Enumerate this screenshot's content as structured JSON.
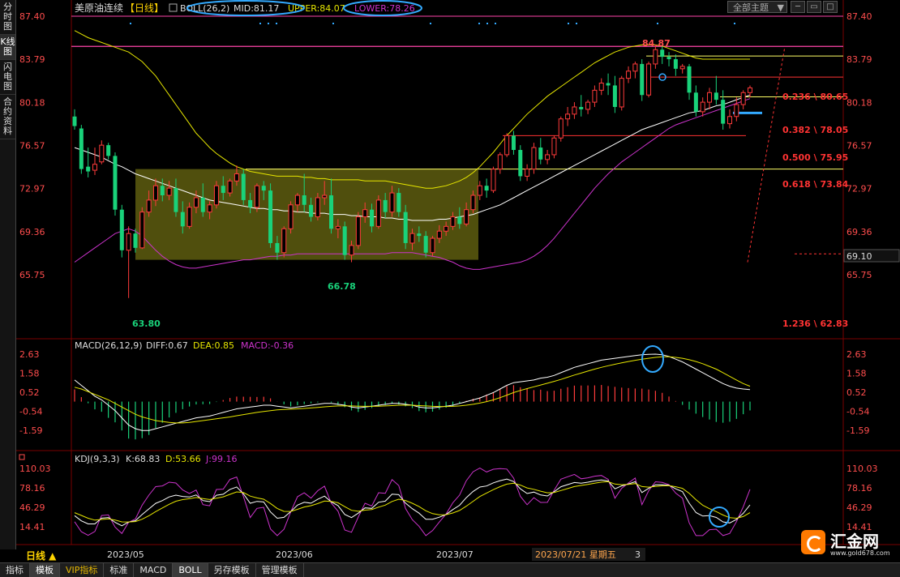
{
  "left_toolbar": [
    {
      "label": "分时图"
    },
    {
      "label": "K线图",
      "active": true
    },
    {
      "label": "闪电图"
    },
    {
      "label": "合约资料"
    }
  ],
  "header": {
    "symbol": "美原油连续",
    "period_tag": "【日线】",
    "boll": "BOLL(26,2)",
    "mid": "MID:81.17",
    "upper": "UPPER:84.07",
    "lower": "LOWER:78.26",
    "theme_select": "全部主题",
    "theme_arrow": "▼"
  },
  "main_axis": {
    "labels": [
      "87.40",
      "83.79",
      "80.18",
      "76.57",
      "72.97",
      "69.36",
      "65.75"
    ],
    "current_price": "69.10"
  },
  "annotations": {
    "high": "84.87",
    "low1": "63.80",
    "low2": "66.78",
    "fib": [
      "0.236 \\ 80.65",
      "0.382 \\ 78.05",
      "0.500 \\ 75.95",
      "0.618 \\ 73.84",
      "1.236 \\ 62.83"
    ]
  },
  "macd": {
    "label": "MACD(26,12,9)",
    "diff": "DIFF:0.67",
    "dea": "DEA:0.85",
    "macd": "MACD:-0.36",
    "axis": [
      "2.63",
      "1.58",
      "0.52",
      "-0.54",
      "-1.59"
    ]
  },
  "kdj": {
    "label": "KDJ(9,3,3)",
    "k": "K:68.83",
    "d": "D:53.66",
    "j": "J:99.16",
    "axis": [
      "110.03",
      "78.16",
      "46.29",
      "14.41"
    ]
  },
  "x_axis": {
    "labels": [
      "2023/05",
      "2023/06",
      "2023/07"
    ],
    "cursor_date": "2023/07/21 星期五",
    "cursor_extra": "3",
    "period": "日线 ▲"
  },
  "bottom_tabs": [
    {
      "label": "指标"
    },
    {
      "label": "模板",
      "active": true
    },
    {
      "label": "VIP指标",
      "vip": true
    },
    {
      "label": "标准"
    },
    {
      "label": "MACD"
    },
    {
      "label": "BOLL",
      "active": true
    },
    {
      "label": "另存模板"
    },
    {
      "label": "管理模板"
    }
  ],
  "logo": {
    "name": "汇金网",
    "site": "www.gold678.com"
  },
  "colors": {
    "up": "#ff3b3b",
    "down": "#19d27a",
    "mid": "#ffffff",
    "upper": "#e6e600",
    "lower": "#cc33cc",
    "box": "#6b6a12",
    "fib_line": "#ffff66",
    "fib_text": "#ff3333",
    "magenta_line": "#ff44aa",
    "circle": "#33aaff",
    "axis_text": "#ff4d4d"
  },
  "chart_data": {
    "type": "candlestick",
    "title": "美原油连续【日线】",
    "y_range": [
      62.0,
      88.0
    ],
    "x_range": [
      "2023/04/14",
      "2023/07/21"
    ],
    "candles": [
      [
        79.0,
        79.6,
        78.2,
        77.9
      ],
      [
        78.0,
        78.3,
        74.6,
        74.2
      ],
      [
        74.8,
        76.4,
        74.4,
        73.9
      ],
      [
        74.5,
        76.4,
        75.0,
        74.1
      ],
      [
        75.2,
        77.0,
        76.6,
        75.0
      ],
      [
        76.6,
        76.8,
        75.7,
        75.4
      ],
      [
        75.7,
        76.0,
        71.2,
        70.7
      ],
      [
        71.2,
        71.6,
        67.8,
        67.2
      ],
      [
        67.8,
        69.8,
        69.2,
        63.8
      ],
      [
        69.2,
        69.6,
        68.0,
        67.6
      ],
      [
        68.0,
        71.4,
        71.0,
        67.9
      ],
      [
        71.0,
        72.8,
        72.0,
        70.6
      ],
      [
        72.0,
        73.8,
        73.2,
        71.5
      ],
      [
        73.2,
        73.8,
        72.4,
        71.9
      ],
      [
        72.4,
        73.6,
        73.0,
        72.0
      ],
      [
        73.0,
        73.8,
        71.0,
        70.6
      ],
      [
        71.0,
        71.9,
        69.8,
        69.2
      ],
      [
        69.8,
        71.8,
        71.4,
        69.6
      ],
      [
        71.4,
        72.8,
        72.2,
        70.9
      ],
      [
        72.2,
        73.4,
        71.0,
        70.6
      ],
      [
        71.0,
        71.9,
        71.6,
        70.4
      ],
      [
        71.6,
        73.6,
        73.2,
        71.3
      ],
      [
        73.2,
        74.0,
        72.6,
        72.0
      ],
      [
        72.6,
        73.8,
        73.6,
        72.3
      ],
      [
        73.6,
        74.9,
        74.2,
        73.2
      ],
      [
        74.2,
        74.6,
        72.0,
        71.6
      ],
      [
        72.0,
        72.6,
        71.4,
        70.9
      ],
      [
        71.4,
        73.4,
        73.2,
        71.0
      ],
      [
        73.2,
        73.6,
        72.8,
        72.0
      ],
      [
        72.8,
        73.4,
        68.4,
        68.0
      ],
      [
        68.4,
        69.0,
        67.6,
        67.0
      ],
      [
        67.6,
        69.8,
        69.6,
        67.2
      ],
      [
        69.6,
        71.9,
        71.6,
        69.2
      ],
      [
        71.6,
        72.6,
        72.4,
        71.0
      ],
      [
        72.4,
        74.2,
        71.6,
        71.0
      ],
      [
        71.6,
        72.2,
        70.6,
        70.2
      ],
      [
        70.6,
        72.6,
        72.2,
        70.3
      ],
      [
        72.2,
        73.6,
        72.4,
        71.6
      ],
      [
        72.4,
        73.8,
        69.6,
        69.2
      ],
      [
        69.6,
        70.4,
        69.8,
        68.8
      ],
      [
        69.8,
        70.2,
        67.4,
        67.0
      ],
      [
        67.4,
        68.6,
        68.2,
        66.8
      ],
      [
        68.2,
        71.0,
        70.6,
        67.9
      ],
      [
        70.6,
        71.8,
        71.2,
        70.1
      ],
      [
        71.2,
        71.7,
        69.8,
        69.3
      ],
      [
        69.8,
        72.4,
        72.0,
        69.6
      ],
      [
        72.0,
        72.6,
        71.0,
        70.5
      ],
      [
        71.0,
        73.2,
        72.6,
        70.6
      ],
      [
        72.6,
        73.0,
        71.0,
        70.6
      ],
      [
        71.0,
        71.6,
        68.4,
        67.9
      ],
      [
        68.4,
        69.6,
        69.2,
        67.8
      ],
      [
        69.2,
        69.8,
        69.0,
        68.5
      ],
      [
        69.0,
        69.4,
        67.6,
        67.2
      ],
      [
        67.6,
        69.0,
        68.8,
        67.3
      ],
      [
        68.8,
        69.9,
        69.4,
        68.4
      ],
      [
        69.4,
        70.2,
        69.8,
        69.0
      ],
      [
        69.8,
        71.0,
        70.6,
        69.5
      ],
      [
        70.6,
        71.4,
        70.0,
        69.6
      ],
      [
        70.0,
        71.8,
        71.2,
        69.8
      ],
      [
        71.2,
        72.8,
        72.4,
        70.9
      ],
      [
        72.4,
        73.6,
        73.2,
        72.0
      ],
      [
        73.2,
        73.8,
        72.8,
        72.2
      ],
      [
        72.8,
        74.8,
        74.6,
        72.6
      ],
      [
        74.6,
        76.0,
        75.8,
        74.2
      ],
      [
        75.8,
        77.6,
        77.4,
        75.6
      ],
      [
        77.4,
        77.8,
        76.2,
        75.8
      ],
      [
        76.2,
        76.6,
        74.0,
        73.6
      ],
      [
        74.0,
        75.0,
        74.6,
        73.6
      ],
      [
        74.6,
        76.8,
        76.4,
        74.2
      ],
      [
        76.4,
        77.2,
        75.4,
        75.0
      ],
      [
        75.4,
        76.2,
        75.8,
        75.0
      ],
      [
        75.8,
        77.4,
        77.2,
        75.5
      ],
      [
        77.2,
        79.0,
        78.8,
        76.9
      ],
      [
        78.8,
        79.8,
        79.2,
        78.2
      ],
      [
        79.2,
        80.2,
        79.8,
        78.8
      ],
      [
        79.8,
        80.8,
        79.6,
        79.0
      ],
      [
        79.6,
        80.4,
        80.2,
        79.2
      ],
      [
        80.2,
        81.6,
        81.2,
        79.8
      ],
      [
        81.2,
        82.2,
        81.8,
        80.8
      ],
      [
        81.8,
        82.6,
        81.6,
        80.8
      ],
      [
        81.6,
        82.4,
        79.8,
        79.3
      ],
      [
        79.8,
        82.4,
        82.2,
        79.5
      ],
      [
        82.2,
        83.2,
        82.8,
        81.8
      ],
      [
        82.8,
        83.6,
        83.4,
        82.2
      ],
      [
        83.4,
        83.8,
        80.8,
        80.3
      ],
      [
        80.8,
        83.6,
        83.4,
        80.6
      ],
      [
        83.4,
        84.9,
        84.6,
        83.0
      ],
      [
        84.6,
        84.87,
        84.0,
        83.4
      ],
      [
        84.0,
        84.4,
        83.8,
        83.2
      ],
      [
        83.8,
        84.2,
        83.0,
        82.4
      ],
      [
        83.0,
        83.4,
        83.2,
        82.6
      ],
      [
        83.2,
        83.4,
        81.0,
        80.4
      ],
      [
        81.0,
        81.6,
        79.4,
        79.0
      ],
      [
        79.4,
        80.6,
        80.2,
        79.0
      ],
      [
        80.2,
        81.4,
        81.0,
        79.6
      ],
      [
        81.0,
        82.4,
        80.4,
        80.0
      ],
      [
        80.4,
        81.2,
        78.4,
        77.9
      ],
      [
        78.4,
        79.6,
        79.0,
        78.0
      ],
      [
        79.0,
        80.6,
        80.0,
        78.6
      ],
      [
        80.0,
        81.2,
        81.0,
        79.6
      ],
      [
        81.0,
        81.6,
        81.4,
        80.6
      ]
    ],
    "boll_mid": [
      76.4,
      76.2,
      76.0,
      75.8,
      75.6,
      75.3,
      75.0,
      74.8,
      74.5,
      74.2,
      74.0,
      73.8,
      73.6,
      73.4,
      73.2,
      73.0,
      72.8,
      72.6,
      72.4,
      72.2,
      72.0,
      71.9,
      71.8,
      71.7,
      71.6,
      71.5,
      71.4,
      71.3,
      71.3,
      71.2,
      71.2,
      71.1,
      71.1,
      71.0,
      71.0,
      70.9,
      70.9,
      70.9,
      70.8,
      70.8,
      70.8,
      70.7,
      70.7,
      70.6,
      70.6,
      70.6,
      70.5,
      70.5,
      70.4,
      70.4,
      70.3,
      70.3,
      70.3,
      70.3,
      70.4,
      70.4,
      70.5,
      70.6,
      70.7,
      70.8,
      71.0,
      71.2,
      71.4,
      71.6,
      71.9,
      72.2,
      72.5,
      72.8,
      73.1,
      73.4,
      73.7,
      74.0,
      74.3,
      74.6,
      74.9,
      75.2,
      75.5,
      75.8,
      76.1,
      76.4,
      76.7,
      77.0,
      77.3,
      77.6,
      77.9,
      78.1,
      78.3,
      78.5,
      78.7,
      78.9,
      79.1,
      79.3,
      79.4,
      79.5,
      79.7,
      79.9,
      80.0,
      80.2,
      80.4,
      80.6,
      80.8
    ],
    "boll_upper": [
      86.2,
      85.9,
      85.6,
      85.4,
      85.2,
      85.0,
      84.8,
      84.6,
      84.4,
      84.0,
      83.6,
      83.0,
      82.4,
      81.6,
      80.8,
      80.0,
      79.2,
      78.4,
      77.6,
      77.0,
      76.4,
      75.9,
      75.5,
      75.1,
      74.8,
      74.6,
      74.4,
      74.3,
      74.2,
      74.1,
      74.0,
      74.0,
      74.0,
      74.0,
      73.9,
      73.9,
      73.8,
      73.8,
      73.7,
      73.7,
      73.7,
      73.7,
      73.7,
      73.6,
      73.6,
      73.6,
      73.6,
      73.5,
      73.4,
      73.3,
      73.2,
      73.1,
      73.0,
      73.0,
      73.1,
      73.2,
      73.4,
      73.6,
      73.9,
      74.3,
      74.8,
      75.4,
      76.0,
      76.7,
      77.4,
      78.0,
      78.6,
      79.2,
      79.7,
      80.2,
      80.7,
      81.1,
      81.5,
      81.9,
      82.3,
      82.7,
      83.1,
      83.5,
      83.8,
      84.1,
      84.4,
      84.6,
      84.8,
      84.9,
      85.0,
      85.0,
      85.0,
      84.9,
      84.7,
      84.5,
      84.3,
      84.1,
      83.9,
      83.8,
      83.8,
      83.8,
      83.8,
      83.8,
      83.8,
      83.8,
      83.8
    ],
    "boll_lower": [
      66.8,
      67.2,
      67.6,
      68.0,
      68.4,
      68.8,
      69.2,
      69.4,
      69.6,
      69.4,
      69.0,
      68.4,
      67.8,
      67.3,
      66.9,
      66.6,
      66.4,
      66.3,
      66.3,
      66.4,
      66.5,
      66.6,
      66.7,
      66.8,
      66.9,
      67.0,
      67.0,
      67.1,
      67.2,
      67.3,
      67.3,
      67.4,
      67.4,
      67.5,
      67.5,
      67.5,
      67.5,
      67.5,
      67.5,
      67.5,
      67.5,
      67.5,
      67.5,
      67.5,
      67.5,
      67.5,
      67.5,
      67.6,
      67.6,
      67.6,
      67.6,
      67.5,
      67.4,
      67.3,
      67.2,
      67.0,
      66.8,
      66.5,
      66.3,
      66.2,
      66.2,
      66.3,
      66.4,
      66.5,
      66.6,
      66.7,
      66.8,
      67.0,
      67.3,
      67.7,
      68.2,
      68.8,
      69.5,
      70.2,
      70.9,
      71.6,
      72.3,
      73.0,
      73.6,
      74.2,
      74.7,
      75.2,
      75.6,
      76.0,
      76.4,
      76.8,
      77.2,
      77.6,
      78.0,
      78.3,
      78.5,
      78.7,
      78.9,
      79.1,
      79.3,
      79.5,
      79.7,
      79.9,
      80.1,
      80.3,
      80.5
    ],
    "fib_levels": [
      80.65,
      78.05,
      75.95,
      73.84,
      62.83
    ],
    "macd_diff": [
      1.2,
      0.9,
      0.6,
      0.3,
      0.1,
      -0.2,
      -0.5,
      -0.9,
      -1.3,
      -1.5,
      -1.6,
      -1.6,
      -1.5,
      -1.4,
      -1.3,
      -1.2,
      -1.1,
      -1.0,
      -0.9,
      -0.85,
      -0.8,
      -0.7,
      -0.6,
      -0.5,
      -0.4,
      -0.35,
      -0.3,
      -0.25,
      -0.2,
      -0.2,
      -0.25,
      -0.3,
      -0.35,
      -0.3,
      -0.25,
      -0.2,
      -0.15,
      -0.1,
      -0.1,
      -0.15,
      -0.2,
      -0.3,
      -0.35,
      -0.3,
      -0.25,
      -0.2,
      -0.15,
      -0.1,
      -0.1,
      -0.15,
      -0.2,
      -0.3,
      -0.35,
      -0.35,
      -0.3,
      -0.25,
      -0.2,
      -0.1,
      0.0,
      0.1,
      0.2,
      0.35,
      0.5,
      0.7,
      0.9,
      1.05,
      1.1,
      1.15,
      1.2,
      1.3,
      1.35,
      1.45,
      1.6,
      1.75,
      1.9,
      2.0,
      2.1,
      2.2,
      2.3,
      2.35,
      2.4,
      2.45,
      2.5,
      2.55,
      2.6,
      2.62,
      2.63,
      2.6,
      2.5,
      2.35,
      2.2,
      2.0,
      1.8,
      1.6,
      1.4,
      1.2,
      1.0,
      0.85,
      0.75,
      0.7,
      0.67
    ],
    "macd_dea": [
      0.8,
      0.7,
      0.55,
      0.4,
      0.25,
      0.1,
      -0.1,
      -0.3,
      -0.5,
      -0.7,
      -0.85,
      -0.95,
      -1.05,
      -1.1,
      -1.15,
      -1.18,
      -1.18,
      -1.15,
      -1.1,
      -1.05,
      -1.0,
      -0.95,
      -0.9,
      -0.85,
      -0.78,
      -0.72,
      -0.66,
      -0.6,
      -0.55,
      -0.5,
      -0.46,
      -0.43,
      -0.42,
      -0.4,
      -0.38,
      -0.35,
      -0.32,
      -0.29,
      -0.26,
      -0.24,
      -0.23,
      -0.24,
      -0.25,
      -0.26,
      -0.26,
      -0.25,
      -0.24,
      -0.22,
      -0.2,
      -0.2,
      -0.2,
      -0.22,
      -0.24,
      -0.26,
      -0.27,
      -0.27,
      -0.26,
      -0.24,
      -0.2,
      -0.15,
      -0.08,
      0.0,
      0.1,
      0.22,
      0.36,
      0.5,
      0.62,
      0.72,
      0.82,
      0.92,
      1.02,
      1.12,
      1.23,
      1.35,
      1.47,
      1.58,
      1.69,
      1.8,
      1.9,
      1.99,
      2.07,
      2.15,
      2.22,
      2.29,
      2.35,
      2.4,
      2.45,
      2.48,
      2.48,
      2.45,
      2.4,
      2.32,
      2.22,
      2.1,
      1.95,
      1.8,
      1.6,
      1.4,
      1.2,
      1.0,
      0.85
    ]
  }
}
